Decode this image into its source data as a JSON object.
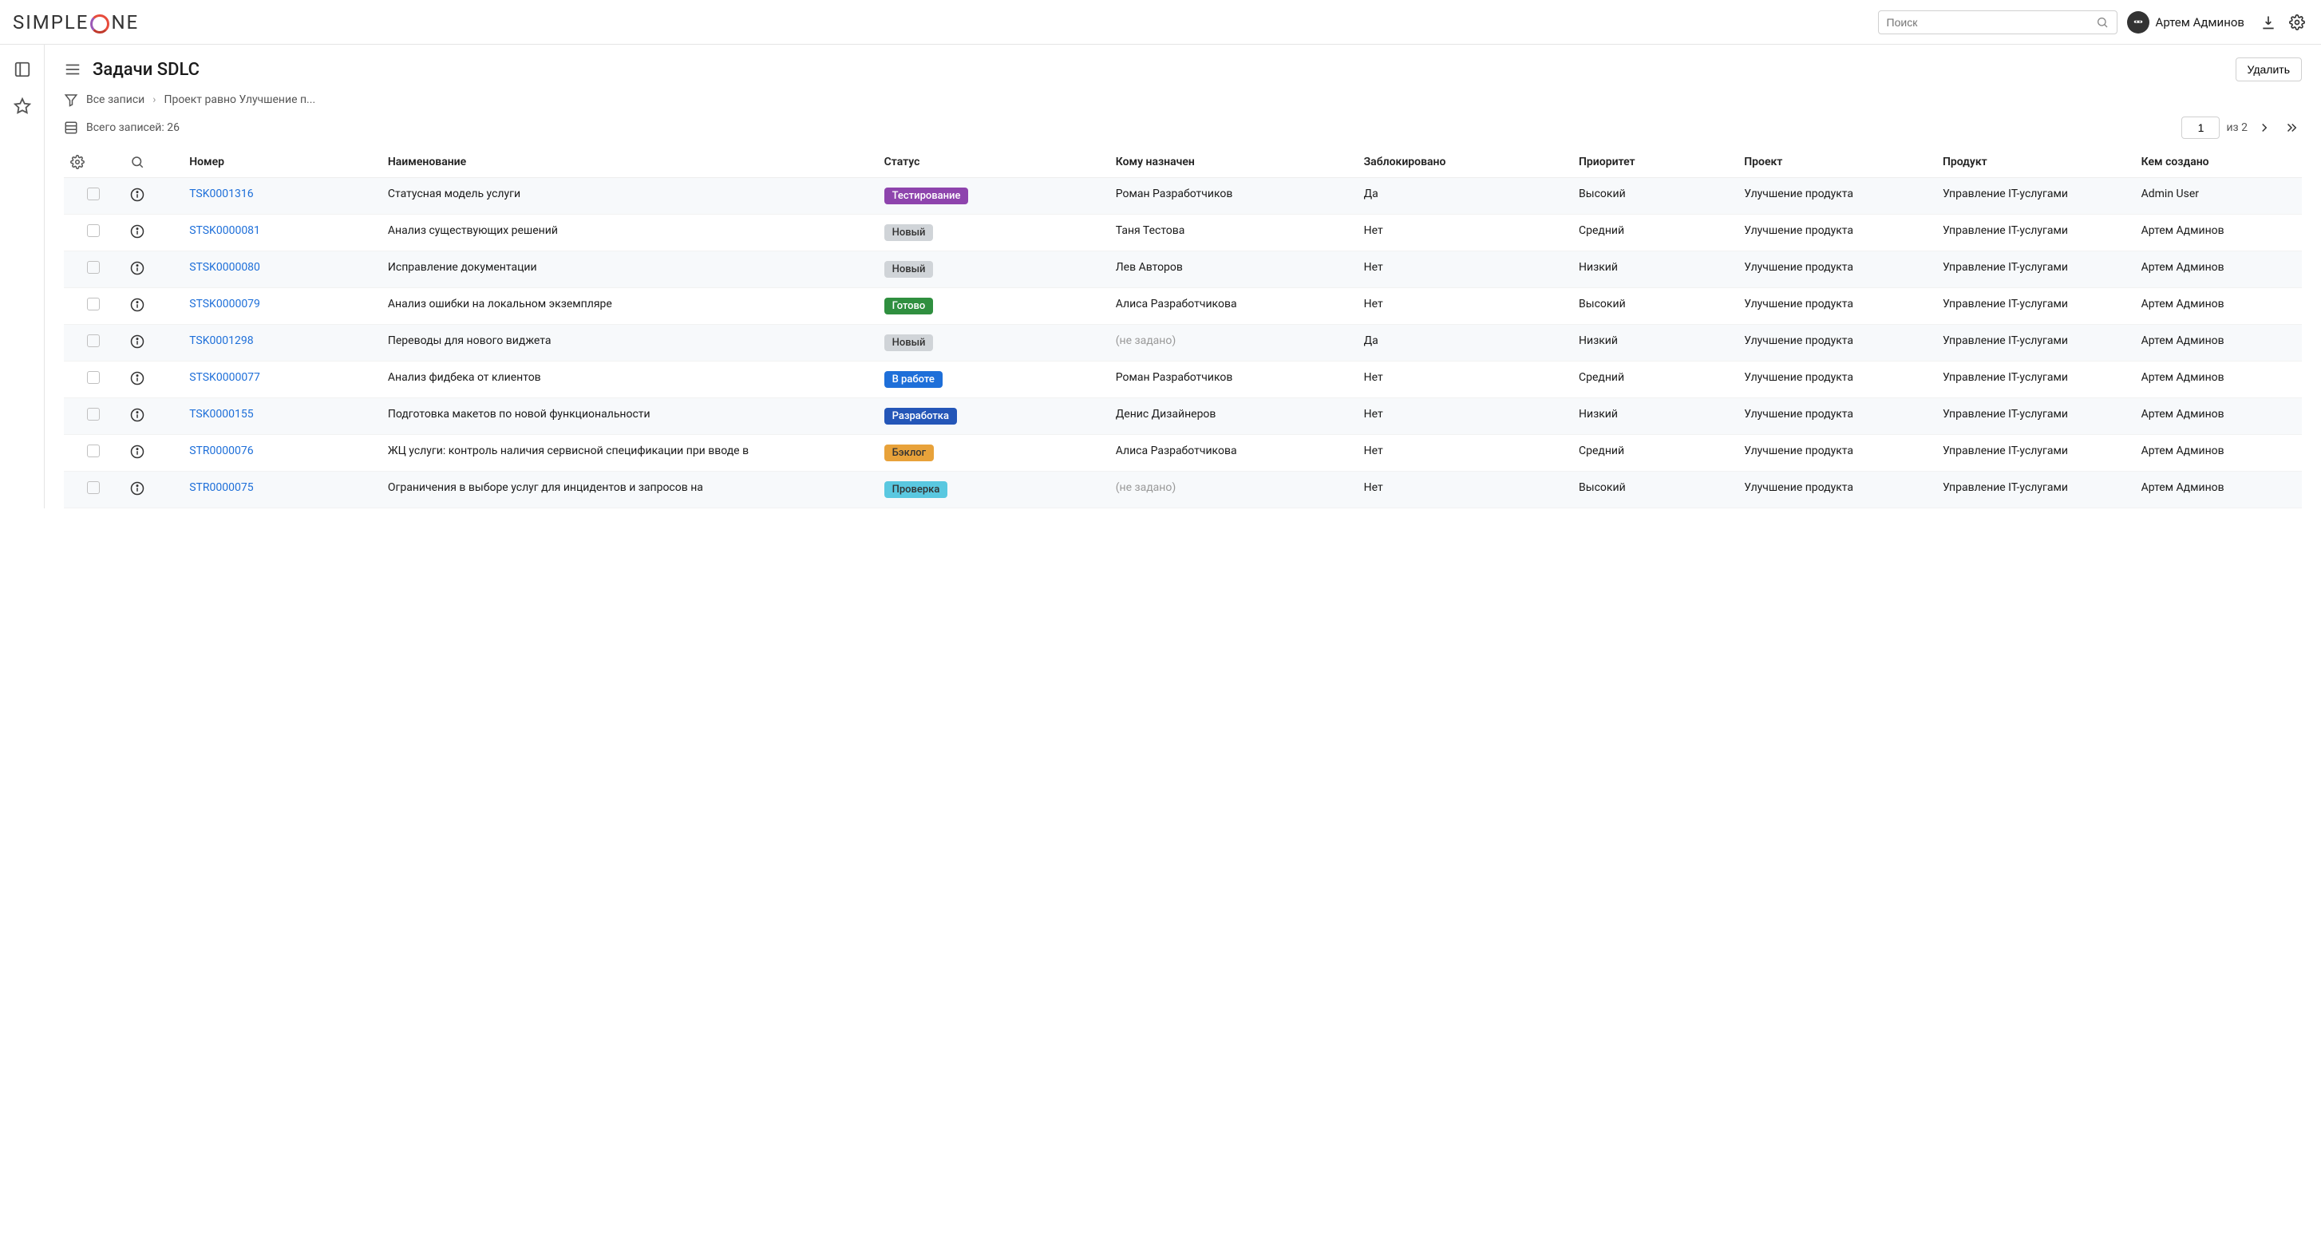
{
  "header": {
    "search_placeholder": "Поиск",
    "user_name": "Артем Админов"
  },
  "page": {
    "title": "Задачи SDLC",
    "delete_label": "Удалить",
    "breadcrumb_all": "Все записи",
    "breadcrumb_filter": "Проект равно Улучшение п...",
    "records_label": "Всего записей: 26",
    "page_input": "1",
    "page_of": "из 2"
  },
  "columns": {
    "number": "Номер",
    "name": "Наименование",
    "status": "Статус",
    "assigned": "Кому назначен",
    "blocked": "Заблокировано",
    "priority": "Приоритет",
    "project": "Проект",
    "product": "Продукт",
    "creator": "Кем создано"
  },
  "status_colors": {
    "Тестирование": "#8e44ad",
    "Новый": "#d0d4d8",
    "Готово": "#2f8f3f",
    "В работе": "#1e6fd9",
    "Разработка": "#2456b8",
    "Бэклог": "#e8a23a",
    "Проверка": "#5ac8e0"
  },
  "status_text_colors": {
    "Новый": "#333",
    "Бэклог": "#333",
    "Проверка": "#333"
  },
  "rows": [
    {
      "num": "TSK0001316",
      "name": "Статусная модель услуги",
      "status": "Тестирование",
      "assigned": "Роман Разработчиков",
      "blocked": "Да",
      "priority": "Высокий",
      "project": "Улучшение продукта",
      "product": "Управление IT-услугами",
      "creator": "Admin User"
    },
    {
      "num": "STSK0000081",
      "name": "Анализ существующих решений",
      "status": "Новый",
      "assigned": "Таня Тестова",
      "blocked": "Нет",
      "priority": "Средний",
      "project": "Улучшение продукта",
      "product": "Управление IT-услугами",
      "creator": "Артем Админов"
    },
    {
      "num": "STSK0000080",
      "name": "Исправление документации",
      "status": "Новый",
      "assigned": "Лев Авторов",
      "blocked": "Нет",
      "priority": "Низкий",
      "project": "Улучшение продукта",
      "product": "Управление IT-услугами",
      "creator": "Артем Админов"
    },
    {
      "num": "STSK0000079",
      "name": "Анализ ошибки на локальном экземпляре",
      "status": "Готово",
      "assigned": "Алиса Разработчикова",
      "blocked": "Нет",
      "priority": "Высокий",
      "project": "Улучшение продукта",
      "product": "Управление IT-услугами",
      "creator": "Артем Админов"
    },
    {
      "num": "TSK0001298",
      "name": "Переводы для нового виджета",
      "status": "Новый",
      "assigned": "(не задано)",
      "assigned_muted": true,
      "blocked": "Да",
      "priority": "Низкий",
      "project": "Улучшение продукта",
      "product": "Управление IT-услугами",
      "creator": "Артем Админов"
    },
    {
      "num": "STSK0000077",
      "name": "Анализ фидбека от клиентов",
      "status": "В работе",
      "assigned": "Роман Разработчиков",
      "blocked": "Нет",
      "priority": "Средний",
      "project": "Улучшение продукта",
      "product": "Управление IT-услугами",
      "creator": "Артем Админов"
    },
    {
      "num": "TSK0000155",
      "name": "Подготовка макетов по новой функциональности",
      "status": "Разработка",
      "assigned": "Денис Дизайнеров",
      "blocked": "Нет",
      "priority": "Низкий",
      "project": "Улучшение продукта",
      "product": "Управление IT-услугами",
      "creator": "Артем Админов"
    },
    {
      "num": "STR0000076",
      "name": "ЖЦ услуги: контроль наличия сервисной спецификации при вводе в",
      "status": "Бэклог",
      "assigned": "Алиса Разработчикова",
      "blocked": "Нет",
      "priority": "Средний",
      "project": "Улучшение продукта",
      "product": "Управление IT-услугами",
      "creator": "Артем Админов"
    },
    {
      "num": "STR0000075",
      "name": "Ограничения в выборе услуг для инцидентов и запросов на",
      "status": "Проверка",
      "assigned": "(не задано)",
      "assigned_muted": true,
      "blocked": "Нет",
      "priority": "Высокий",
      "project": "Улучшение продукта",
      "product": "Управление IT-услугами",
      "creator": "Артем Админов"
    }
  ]
}
